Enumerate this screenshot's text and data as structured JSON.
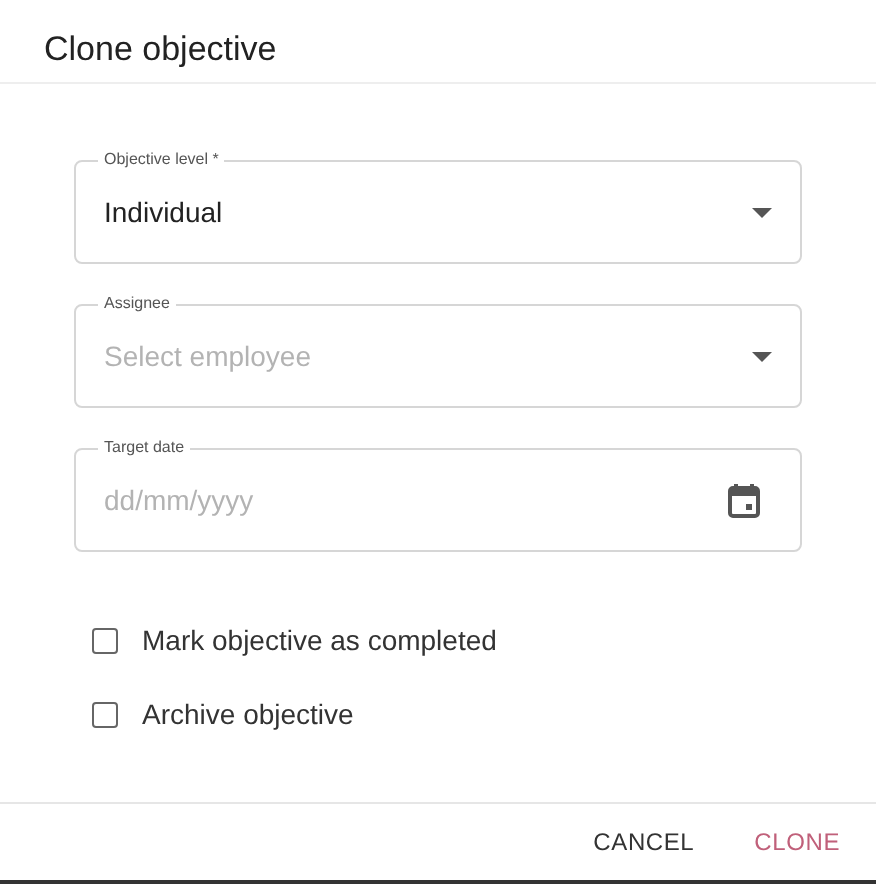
{
  "dialog": {
    "title": "Clone objective"
  },
  "fields": [
    {
      "kind": "select",
      "label": "Objective level *",
      "value": "Individual"
    },
    {
      "kind": "select",
      "label": "Assignee",
      "placeholder": "Select employee"
    },
    {
      "kind": "date",
      "label": "Target date",
      "placeholder": "dd/mm/yyyy"
    }
  ],
  "checkboxes": [
    {
      "label": "Mark objective as completed",
      "checked": false
    },
    {
      "label": "Archive objective",
      "checked": false
    }
  ],
  "buttons": [
    {
      "label": "CANCEL",
      "kind": "secondary"
    },
    {
      "label": "CLONE",
      "kind": "primary"
    }
  ]
}
